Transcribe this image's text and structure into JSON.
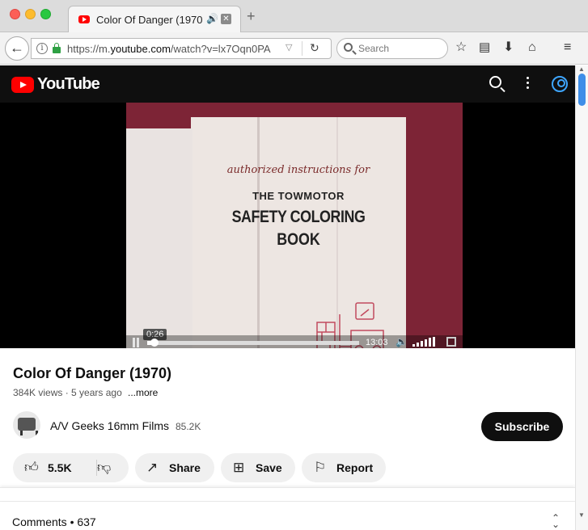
{
  "browser": {
    "tab_title": "Color Of Danger (1970...",
    "audio_icon": "speaker-icon",
    "close_icon": "close-icon",
    "new_tab_label": "+",
    "url_prefix": "https://m.",
    "url_host": "youtube.com",
    "url_path": "/watch?v=lx7Oqn0PA",
    "search_placeholder": "Search"
  },
  "youtube": {
    "logo_text": "YouTube",
    "player": {
      "book_line1": "authorized instructions for",
      "book_line2": "THE TOWMOTOR",
      "book_line3": "SAFETY COLORING",
      "book_line4": "BOOK",
      "current_time": "0:26",
      "duration": "13:03",
      "progress_fraction": 0.033
    },
    "video": {
      "title": "Color Of Danger (1970)",
      "meta": "384K views · 5 years ago",
      "more_label": "...more"
    },
    "channel": {
      "name": "A/V Geeks 16mm Films",
      "subscribers": "85.2K",
      "subscribe_label": "Subscribe"
    },
    "actions": {
      "likes": "5.5K",
      "share": "Share",
      "save": "Save",
      "report": "Report"
    },
    "comments": {
      "label": "Comments • 637"
    }
  }
}
